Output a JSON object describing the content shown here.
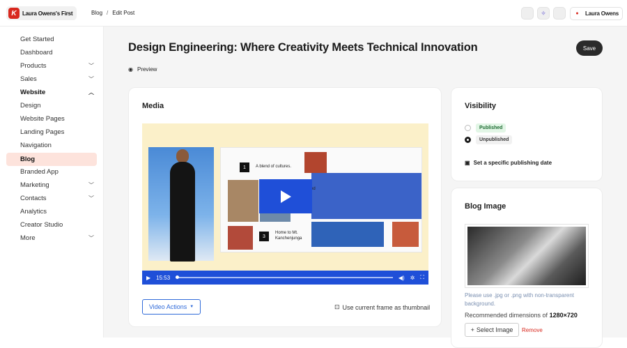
{
  "topbar": {
    "brand_name": "Laura Owens's First",
    "breadcrumb": [
      "Blog",
      "/",
      "Edit Post"
    ],
    "user_name": "Laura Owens"
  },
  "sidebar": {
    "items": [
      {
        "label": "Get Started",
        "chevron": false
      },
      {
        "label": "Dashboard",
        "chevron": false
      },
      {
        "label": "Products",
        "chevron": "down"
      },
      {
        "label": "Sales",
        "chevron": "down"
      },
      {
        "label": "Website",
        "chevron": "up"
      },
      {
        "label": "Design",
        "chevron": false
      },
      {
        "label": "Website Pages",
        "chevron": false
      },
      {
        "label": "Landing Pages",
        "chevron": false
      },
      {
        "label": "Navigation",
        "chevron": false
      },
      {
        "label": "Blog",
        "chevron": false
      },
      {
        "label": "Branded App",
        "chevron": false
      },
      {
        "label": "Marketing",
        "chevron": "down"
      },
      {
        "label": "Contacts",
        "chevron": "down"
      },
      {
        "label": "Analytics",
        "chevron": false
      },
      {
        "label": "Creator Studio",
        "chevron": false
      },
      {
        "label": "More",
        "chevron": "down"
      }
    ]
  },
  "header": {
    "title": "Design Engineering: Where Creativity Meets Technical Innovation",
    "save_label": "Save",
    "preview_label": "Preview"
  },
  "media": {
    "title": "Media",
    "video_time": "15:53",
    "slide_text": {
      "item1_num": "1",
      "item1": "A blend of cultures.",
      "item3_num": "3",
      "item3": "Home to Mt. Kanchenjunga",
      "item2_fragment": "sed"
    },
    "video_actions_label": "Video Actions",
    "thumbnail_label": "Use current frame as thumbnail"
  },
  "visibility": {
    "title": "Visibility",
    "options": [
      {
        "label": "Published",
        "selected": false
      },
      {
        "label": "Unpublished",
        "selected": true
      }
    ],
    "schedule_label": "Set a specific publishing date"
  },
  "blog_image": {
    "title": "Blog Image",
    "hint": "Please use .jpg or .png with non-transparent background.",
    "dims_prefix": "Recommended dimensions of",
    "dims_value": "1280×720",
    "select_label": "Select Image",
    "remove_label": "Remove"
  },
  "colors": {
    "accent": "#2f6ad9",
    "brand": "#d8281e",
    "active_nav": "#fde3dc"
  }
}
